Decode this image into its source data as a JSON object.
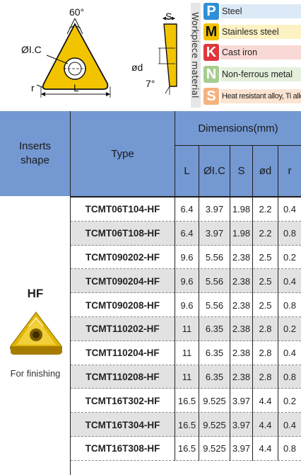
{
  "diagram": {
    "angle_label": "60°",
    "ic_label": "ØI.C",
    "r_label": "r",
    "l_label": "L",
    "s_label": "S",
    "od_label": "ød",
    "deg_label": "7°"
  },
  "legend": {
    "caption": "Workpiece material",
    "items": [
      {
        "letter": "P",
        "label": "Steel",
        "letter_color": "#2f8fd6",
        "bg_color": "#dceaf7"
      },
      {
        "letter": "M",
        "label": "Stainless steel",
        "letter_color": "#f2c200",
        "bg_color": "#fdf2c4"
      },
      {
        "letter": "K",
        "label": "Cast iron",
        "letter_color": "#e0363d",
        "bg_color": "#f9d9d6"
      },
      {
        "letter": "N",
        "label": "Non-ferrous metal",
        "letter_color": "#a6cd8f",
        "bg_color": "#e4f0dc"
      },
      {
        "letter": "S",
        "label": "Heat resistant alloy, Ti alloy",
        "letter_color": "#f6b27e",
        "bg_color": "#fbe4d2"
      }
    ]
  },
  "table": {
    "header": {
      "shape": "Inserts shape",
      "type": "Type",
      "dimensions": "Dimensions(mm)",
      "columns": [
        "L",
        "ØI.C",
        "S",
        "ød",
        "r"
      ]
    },
    "shape_name": "HF",
    "shape_caption": "For finishing",
    "rows": [
      {
        "type": "TCMT06T104-HF",
        "L": "6.4",
        "IC": "3.97",
        "S": "1.98",
        "d": "2.2",
        "r": "0.4"
      },
      {
        "type": "TCMT06T108-HF",
        "L": "6.4",
        "IC": "3.97",
        "S": "1.98",
        "d": "2.2",
        "r": "0.8"
      },
      {
        "type": "TCMT090202-HF",
        "L": "9.6",
        "IC": "5.56",
        "S": "2.38",
        "d": "2.5",
        "r": "0.2"
      },
      {
        "type": "TCMT090204-HF",
        "L": "9.6",
        "IC": "5.56",
        "S": "2.38",
        "d": "2.5",
        "r": "0.4"
      },
      {
        "type": "TCMT090208-HF",
        "L": "9.6",
        "IC": "5.56",
        "S": "2.38",
        "d": "2.5",
        "r": "0.8"
      },
      {
        "type": "TCMT110202-HF",
        "L": "11",
        "IC": "6.35",
        "S": "2.38",
        "d": "2.8",
        "r": "0.2"
      },
      {
        "type": "TCMT110204-HF",
        "L": "11",
        "IC": "6.35",
        "S": "2.38",
        "d": "2.8",
        "r": "0.4"
      },
      {
        "type": "TCMT110208-HF",
        "L": "11",
        "IC": "6.35",
        "S": "2.38",
        "d": "2.8",
        "r": "0.8"
      },
      {
        "type": "TCMT16T302-HF",
        "L": "16.5",
        "IC": "9.525",
        "S": "3.97",
        "d": "4.4",
        "r": "0.2"
      },
      {
        "type": "TCMT16T304-HF",
        "L": "16.5",
        "IC": "9.525",
        "S": "3.97",
        "d": "4.4",
        "r": "0.4"
      },
      {
        "type": "TCMT16T308-HF",
        "L": "16.5",
        "IC": "9.525",
        "S": "3.97",
        "d": "4.4",
        "r": "0.8"
      }
    ]
  }
}
